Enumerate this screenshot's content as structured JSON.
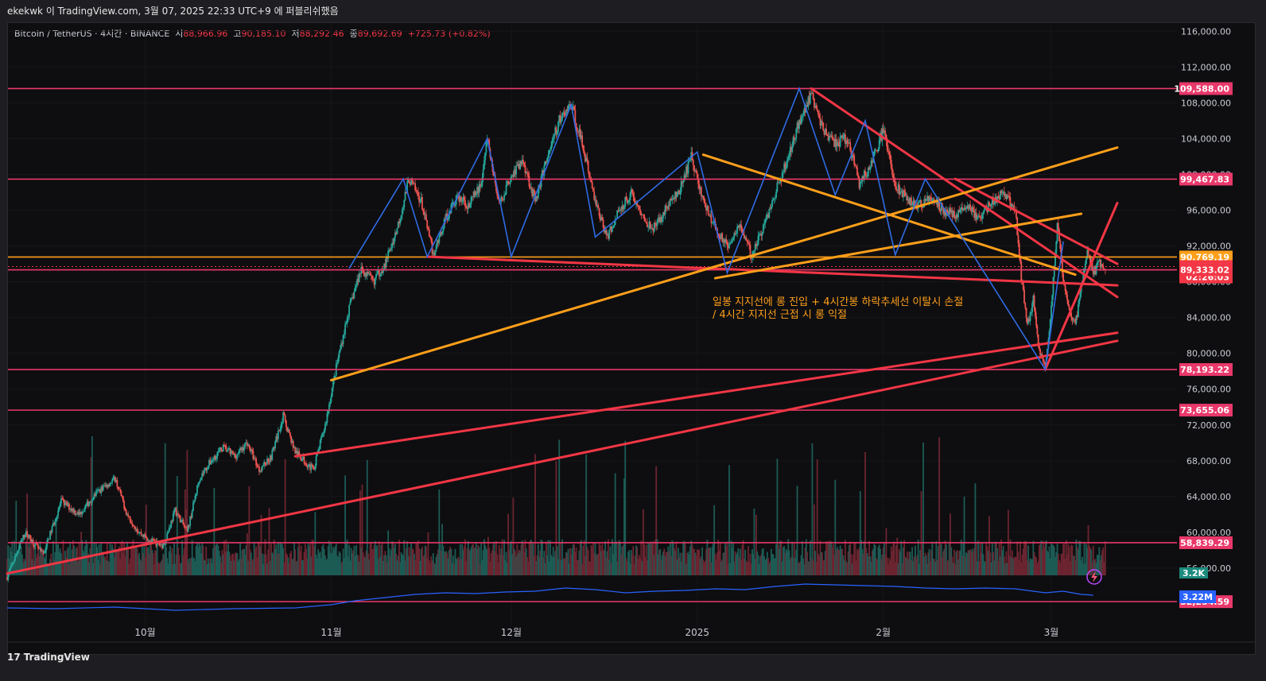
{
  "header": {
    "publish_line": "ekekwk 이 TradingView.com, 3월 07, 2025 22:33 UTC+9 에 퍼블리쉬했음"
  },
  "legend": {
    "symbol": "Bitcoin / TetherUS · 4시간 · BINANCE",
    "open_label": "시",
    "open": "88,966.96",
    "high_label": "고",
    "high": "90,185.10",
    "low_label": "저",
    "low": "88,292.46",
    "close_label": "종",
    "close": "89,692.69",
    "change": "+725.73 (+0.82%)"
  },
  "footer": {
    "brand": "TradingView",
    "logo_glyph": "17"
  },
  "colors": {
    "background": "#0e0e10",
    "horizontal_level": "#e9386a",
    "orange_line": "#ff9f1a",
    "red_trend": "#f23645",
    "zigzag": "#2f6be5",
    "candle_up": "#26a69a",
    "candle_down": "#ef5350",
    "volume_up": "#1c5b55",
    "volume_down": "#6b2530",
    "obv_line": "#2962ff"
  },
  "annotation": {
    "line1": "일봉 지지선에 롱 진입 + 4시간봉 하락추세선 이탈시 손절",
    "line2": " / 4시간 지지선 근접 시 롱 익절"
  },
  "chart_data": {
    "type": "candlestick",
    "title": "",
    "ylim": [
      52000,
      117000
    ],
    "y_ticks": [
      "116,000.00",
      "112,000.00",
      "108,000.00",
      "104,000.00",
      "100,000.00",
      "96,000.00",
      "92,000.00",
      "88,000.00",
      "84,000.00",
      "80,000.00",
      "76,000.00",
      "72,000.00",
      "68,000.00",
      "64,000.00",
      "60,000.00",
      "56,000.00"
    ],
    "y_tick_values": [
      116000,
      112000,
      108000,
      104000,
      100000,
      96000,
      92000,
      88000,
      84000,
      80000,
      76000,
      72000,
      68000,
      64000,
      60000,
      56000
    ],
    "x_ticks": [
      {
        "label": "10월",
        "t": 25
      },
      {
        "label": "11월",
        "t": 56
      },
      {
        "label": "12월",
        "t": 86
      },
      {
        "label": "2025",
        "t": 117
      },
      {
        "label": "2월",
        "t": 148
      },
      {
        "label": "3월",
        "t": 176
      }
    ],
    "x_range_days": [
      2,
      198
    ],
    "price_path": [
      [
        2,
        55000
      ],
      [
        5,
        60000
      ],
      [
        8,
        57500
      ],
      [
        11,
        63500
      ],
      [
        14,
        62000
      ],
      [
        17,
        64500
      ],
      [
        20,
        66000
      ],
      [
        22,
        62000
      ],
      [
        24,
        60000
      ],
      [
        26,
        59000
      ],
      [
        28,
        58500
      ],
      [
        30,
        62500
      ],
      [
        32,
        60000
      ],
      [
        34,
        66000
      ],
      [
        36,
        68000
      ],
      [
        38,
        69500
      ],
      [
        40,
        68500
      ],
      [
        42,
        70000
      ],
      [
        44,
        67000
      ],
      [
        46,
        68500
      ],
      [
        48,
        73000
      ],
      [
        50,
        69000
      ],
      [
        53,
        67000
      ],
      [
        55,
        72000
      ],
      [
        57,
        79000
      ],
      [
        59,
        85000
      ],
      [
        61,
        89500
      ],
      [
        63,
        88000
      ],
      [
        65,
        90000
      ],
      [
        67,
        94000
      ],
      [
        69,
        99500
      ],
      [
        71,
        97000
      ],
      [
        73,
        91000
      ],
      [
        75,
        95000
      ],
      [
        77,
        97500
      ],
      [
        79,
        96500
      ],
      [
        81,
        99000
      ],
      [
        82,
        104000
      ],
      [
        84,
        96500
      ],
      [
        86,
        100000
      ],
      [
        88,
        101500
      ],
      [
        90,
        97000
      ],
      [
        92,
        102000
      ],
      [
        94,
        106000
      ],
      [
        96,
        107800
      ],
      [
        98,
        103000
      ],
      [
        100,
        97000
      ],
      [
        102,
        93000
      ],
      [
        104,
        96000
      ],
      [
        106,
        98000
      ],
      [
        108,
        95000
      ],
      [
        110,
        94000
      ],
      [
        112,
        96500
      ],
      [
        114,
        98000
      ],
      [
        116,
        102000
      ],
      [
        118,
        97000
      ],
      [
        120,
        94000
      ],
      [
        122,
        92000
      ],
      [
        124,
        94500
      ],
      [
        126,
        91000
      ],
      [
        128,
        94000
      ],
      [
        130,
        98000
      ],
      [
        132,
        101500
      ],
      [
        134,
        106000
      ],
      [
        136,
        109000
      ],
      [
        138,
        105000
      ],
      [
        140,
        103500
      ],
      [
        142,
        104000
      ],
      [
        144,
        99000
      ],
      [
        146,
        101000
      ],
      [
        148,
        105000
      ],
      [
        150,
        99000
      ],
      [
        152,
        97000
      ],
      [
        154,
        96500
      ],
      [
        156,
        97500
      ],
      [
        158,
        96000
      ],
      [
        160,
        95500
      ],
      [
        162,
        96500
      ],
      [
        164,
        95000
      ],
      [
        166,
        97000
      ],
      [
        168,
        98000
      ],
      [
        170,
        96000
      ],
      [
        171,
        88500
      ],
      [
        172,
        83000
      ],
      [
        173,
        86000
      ],
      [
        174,
        80000
      ],
      [
        175,
        78500
      ],
      [
        176,
        85000
      ],
      [
        177,
        94500
      ],
      [
        178,
        88000
      ],
      [
        179,
        85000
      ],
      [
        180,
        83000
      ],
      [
        181,
        87500
      ],
      [
        182,
        91500
      ],
      [
        183,
        89000
      ],
      [
        184,
        90000
      ],
      [
        185,
        89700
      ]
    ],
    "last_price": 89692.69,
    "price_labels": [
      {
        "value": 109588.0,
        "text": "109,588.00",
        "bg": "#e9386a"
      },
      {
        "value": 99467.83,
        "text": "99,467.83",
        "bg": "#e9386a"
      },
      {
        "value": 90769.19,
        "text": "90,769.19",
        "bg": "#ff9f1a"
      },
      {
        "value": 89692.69,
        "text": "89,692.69",
        "bg": "#f23645"
      },
      {
        "value": 88500.0,
        "text": "02:26:03",
        "bg": "#f23645"
      },
      {
        "value": 89333.02,
        "text": "89,333.02",
        "bg": "#f23645"
      },
      {
        "value": 78193.22,
        "text": "78,193.22",
        "bg": "#e9386a"
      },
      {
        "value": 73655.06,
        "text": "73,655.06",
        "bg": "#e9386a"
      },
      {
        "value": 58839.29,
        "text": "58,839.29",
        "bg": "#e9386a"
      },
      {
        "value": 52254.59,
        "text": "52,254.59",
        "bg": "#e9386a"
      }
    ],
    "horizontal_levels": [
      109588.0,
      99467.83,
      90769.19,
      89333.02,
      78193.22,
      73655.06,
      58839.29,
      52254.59
    ],
    "trendlines_red": [
      [
        [
          2,
          55400
        ],
        [
          187,
          81400
        ]
      ],
      [
        [
          50,
          68500
        ],
        [
          187,
          82300
        ]
      ],
      [
        [
          72,
          90800
        ],
        [
          187,
          87600
        ]
      ],
      [
        [
          136,
          109600
        ],
        [
          187,
          86300
        ]
      ],
      [
        [
          160,
          99500
        ],
        [
          187,
          90000
        ]
      ],
      [
        [
          175,
          78200
        ],
        [
          187,
          96800
        ]
      ]
    ],
    "trendlines_orange": [
      [
        [
          56,
          77000
        ],
        [
          187,
          103000
        ]
      ],
      [
        [
          120,
          88400
        ],
        [
          181,
          95600
        ]
      ],
      [
        [
          118,
          102200
        ],
        [
          180,
          88800
        ]
      ]
    ],
    "zigzag_blue": [
      [
        59,
        89500
      ],
      [
        68,
        99500
      ],
      [
        72,
        90800
      ],
      [
        82,
        104000
      ],
      [
        86,
        90800
      ],
      [
        96,
        107800
      ],
      [
        100,
        93000
      ],
      [
        117,
        102500
      ],
      [
        122,
        89000
      ],
      [
        134,
        109600
      ],
      [
        140,
        97700
      ],
      [
        145,
        106000
      ],
      [
        150,
        91000
      ],
      [
        155,
        99500
      ],
      [
        175,
        78200
      ],
      [
        178,
        92500
      ]
    ],
    "volume": {
      "label": "3.2K",
      "value": 3200,
      "max_volume": 12000
    },
    "obv": {
      "label": "3.22M",
      "value": 3220000,
      "path": [
        [
          2,
          765
        ],
        [
          10,
          766
        ],
        [
          20,
          764
        ],
        [
          30,
          768
        ],
        [
          40,
          766
        ],
        [
          50,
          765
        ],
        [
          56,
          761
        ],
        [
          60,
          756
        ],
        [
          65,
          752
        ],
        [
          70,
          748
        ],
        [
          75,
          746
        ],
        [
          80,
          747
        ],
        [
          85,
          745
        ],
        [
          90,
          744
        ],
        [
          95,
          740
        ],
        [
          100,
          742
        ],
        [
          105,
          746
        ],
        [
          110,
          744
        ],
        [
          115,
          743
        ],
        [
          120,
          741
        ],
        [
          125,
          742
        ],
        [
          130,
          738
        ],
        [
          135,
          735
        ],
        [
          140,
          736
        ],
        [
          145,
          737
        ],
        [
          150,
          738
        ],
        [
          155,
          740
        ],
        [
          160,
          741
        ],
        [
          165,
          740
        ],
        [
          170,
          741
        ],
        [
          175,
          746
        ],
        [
          178,
          744
        ],
        [
          181,
          748
        ],
        [
          183,
          749
        ]
      ]
    }
  }
}
